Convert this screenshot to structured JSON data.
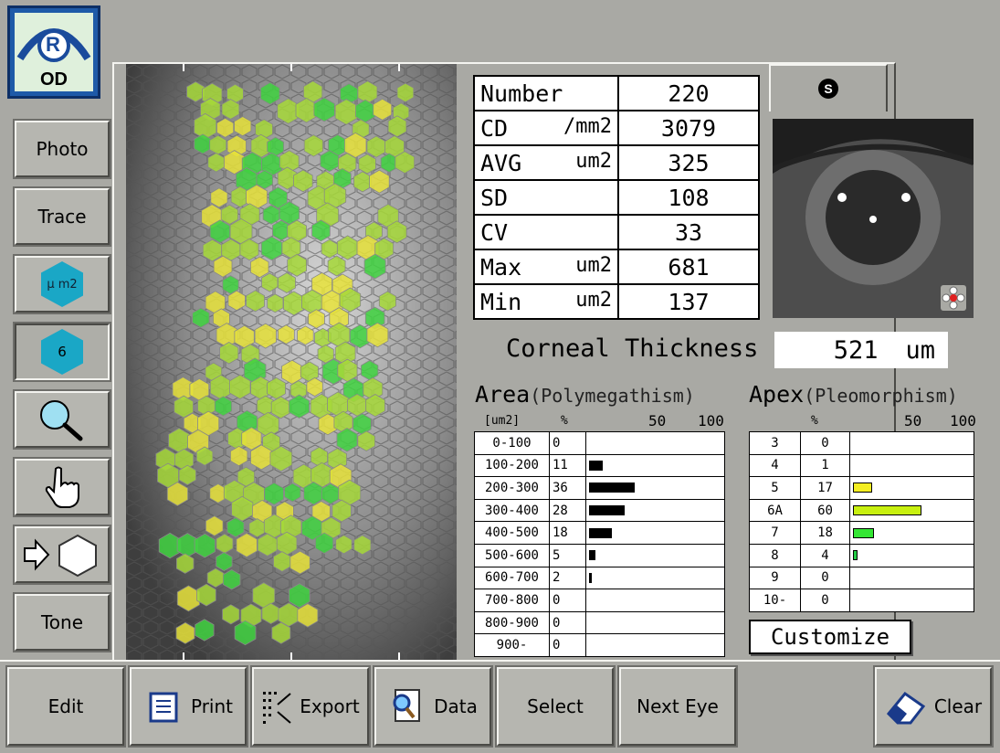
{
  "eye_badge": {
    "letter": "R",
    "label": "OD"
  },
  "side_buttons": [
    {
      "label": "Photo"
    },
    {
      "label": "Trace"
    },
    {
      "label": "μ m2"
    },
    {
      "label": "6"
    },
    {
      "icon": "magnifier-icon"
    },
    {
      "icon": "hand-pointer-icon"
    },
    {
      "icon": "arrow-to-hexagon-icon"
    },
    {
      "label": "Tone"
    }
  ],
  "stats": [
    {
      "name": "Number",
      "unit": "",
      "value": "220"
    },
    {
      "name": "CD",
      "unit": "/mm2",
      "value": "3079"
    },
    {
      "name": "AVG",
      "unit": "um2",
      "value": "325"
    },
    {
      "name": "SD",
      "unit": "",
      "value": "108"
    },
    {
      "name": "CV",
      "unit": "",
      "value": "33"
    },
    {
      "name": "Max",
      "unit": "um2",
      "value": "681"
    },
    {
      "name": "Min",
      "unit": "um2",
      "value": "137"
    }
  ],
  "eye_tab_label": "S",
  "corneal": {
    "label": "Corneal Thickness",
    "value": "521",
    "unit": "um"
  },
  "area": {
    "title": "Area",
    "subtitle": "(Polymegathism)",
    "col_unit": "[um2]",
    "col_pct": "%",
    "scale": [
      "50",
      "100"
    ],
    "rows": [
      {
        "range": "0-100",
        "pct": 0
      },
      {
        "range": "100-200",
        "pct": 11
      },
      {
        "range": "200-300",
        "pct": 36
      },
      {
        "range": "300-400",
        "pct": 28
      },
      {
        "range": "400-500",
        "pct": 18
      },
      {
        "range": "500-600",
        "pct": 5
      },
      {
        "range": "600-700",
        "pct": 2
      },
      {
        "range": "700-800",
        "pct": 0
      },
      {
        "range": "800-900",
        "pct": 0
      },
      {
        "range": "900-",
        "pct": 0
      }
    ]
  },
  "apex": {
    "title": "Apex",
    "subtitle": "(Pleomorphism)",
    "col_pct": "%",
    "scale": [
      "50",
      "100"
    ],
    "rows": [
      {
        "sides": "3",
        "pct": 0,
        "color": ""
      },
      {
        "sides": "4",
        "pct": 1,
        "color": ""
      },
      {
        "sides": "5",
        "pct": 17,
        "color": "#f4ee22"
      },
      {
        "sides": "6A",
        "pct": 60,
        "color": "#c8f010"
      },
      {
        "sides": "7",
        "pct": 18,
        "color": "#33e633"
      },
      {
        "sides": "8",
        "pct": 4,
        "color": "#22cc44"
      },
      {
        "sides": "9",
        "pct": 0,
        "color": ""
      },
      {
        "sides": "10-",
        "pct": 0,
        "color": ""
      }
    ]
  },
  "customize_label": "Customize",
  "bottom_buttons": [
    {
      "label": "Edit",
      "icon": ""
    },
    {
      "label": "Print",
      "icon": "printer-icon"
    },
    {
      "label": "Export",
      "icon": "export-icon"
    },
    {
      "label": "Data",
      "icon": "data-search-icon"
    },
    {
      "label": "Select",
      "icon": ""
    },
    {
      "label": "Next Eye",
      "icon": ""
    },
    {
      "label": "Clear",
      "icon": "eraser-icon"
    }
  ],
  "colors": {
    "background": "#a9a9a4",
    "cell_green": "#3fd23f",
    "cell_yellowgreen": "#a6d838",
    "cell_yellow": "#e6e23a",
    "badge_blue": "#1a4b9c",
    "hex_cyan": "#1aa7c6"
  }
}
